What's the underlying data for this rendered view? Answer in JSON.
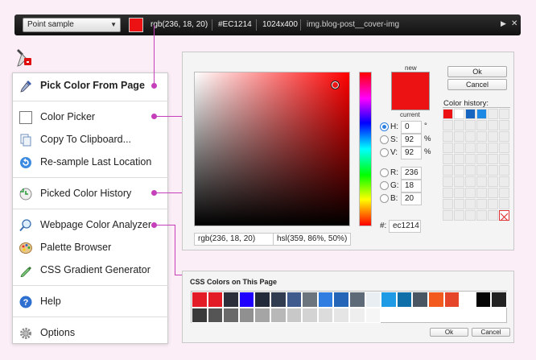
{
  "toolbar": {
    "mode_value": "Point sample",
    "swatch_color": "#ec1214",
    "rgb_text": "rgb(236, 18, 20)",
    "hex_text": "#EC1214",
    "size_text": "1024x400",
    "element_text": "img.blog-post__cover-img",
    "play_icon": "play-icon",
    "close_icon": "close-icon"
  },
  "menu": {
    "items": [
      {
        "label": "Pick Color From Page",
        "icon": "eyedropper-icon"
      },
      {
        "label": "Color Picker",
        "icon": "color-square-icon"
      },
      {
        "label": "Copy To Clipboard...",
        "icon": "clipboard-icon"
      },
      {
        "label": "Re-sample Last Location",
        "icon": "refresh-icon"
      },
      {
        "label": "Picked Color History",
        "icon": "history-icon"
      },
      {
        "label": "Webpage Color Analyzer",
        "icon": "magnifier-icon"
      },
      {
        "label": "Palette Browser",
        "icon": "palette-icon"
      },
      {
        "label": "CSS Gradient Generator",
        "icon": "gradient-pen-icon"
      },
      {
        "label": "Help",
        "icon": "help-icon"
      },
      {
        "label": "Options",
        "icon": "gear-icon"
      }
    ]
  },
  "picker": {
    "new_label": "new",
    "current_label": "current",
    "color": "#ec1214",
    "ok_label": "Ok",
    "cancel_label": "Cancel",
    "history_title": "Color history:",
    "history_colors": [
      "#ec1214",
      "#ffffff",
      "#1565c0",
      "#1e88e5"
    ],
    "fields": {
      "h_label": "H:",
      "h": "0",
      "h_unit": "°",
      "s_label": "S:",
      "s": "92",
      "s_unit": "%",
      "v_label": "V:",
      "v": "92",
      "v_unit": "%",
      "r_label": "R:",
      "r": "236",
      "g_label": "G:",
      "g": "18",
      "b_label": "B:",
      "b": "20",
      "hex_label": "#:",
      "hex": "ec1214"
    },
    "rgb_readout": "rgb(236, 18, 20)",
    "hsl_readout": "hsl(359, 86%, 50%)"
  },
  "css_panel": {
    "title": "CSS Colors on This Page",
    "ok_label": "Ok",
    "cancel_label": "Cancel",
    "row1": [
      "#e21b26",
      "#e21b26",
      "#2c2f3a",
      "#1f00ff",
      "#222a3a",
      "#313c50",
      "#3f5a8c",
      "#6c757d",
      "#2f7de1",
      "#2465b8",
      "#5e6a78",
      "#e9eef3",
      "#1f9be6",
      "#0f6fa8",
      "#4a5763",
      "#f35a1d",
      "#e5462a",
      "#ffffff",
      "#050505",
      "#222222"
    ],
    "row2": [
      "#3a3a3a",
      "#555555",
      "#6a6a6a",
      "#909090",
      "#a5a5a5",
      "#b8b8b8",
      "#c8c8c8",
      "#d3d3d3",
      "#dcdcdc",
      "#e5e5e5",
      "#eeeeee",
      "#f6f6f6"
    ]
  }
}
